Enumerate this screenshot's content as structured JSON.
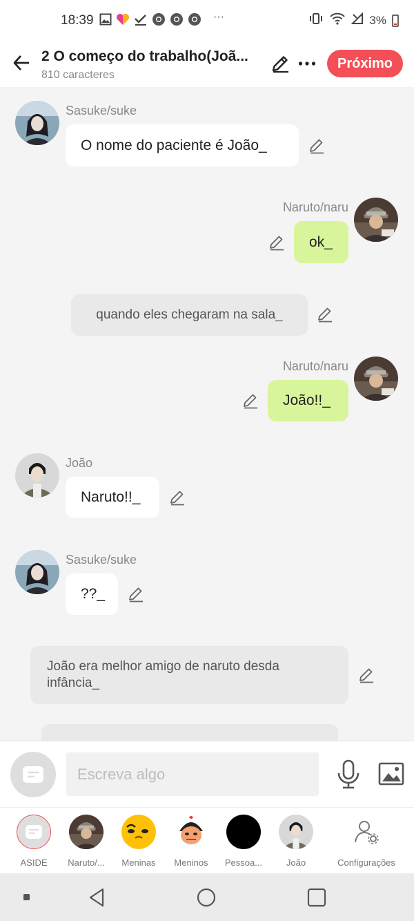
{
  "status_bar": {
    "time": "18:39",
    "battery": "3%"
  },
  "header": {
    "title": "2 O começo do trabalho(Joã...",
    "character_count": "810 caracteres",
    "next_label": "Próximo"
  },
  "messages": [
    {
      "kind": "left",
      "name": "Sasuke/suke",
      "text": "O nome do paciente é João_"
    },
    {
      "kind": "right",
      "name": "Naruto/naru",
      "text": "ok_"
    },
    {
      "kind": "narration",
      "text": "quando eles chegaram na sala_"
    },
    {
      "kind": "right",
      "name": "Naruto/naru",
      "text": "João!!_"
    },
    {
      "kind": "left",
      "name": "João",
      "text": "Naruto!!_"
    },
    {
      "kind": "left",
      "name": "Sasuke/suke",
      "text": "??_"
    },
    {
      "kind": "narration",
      "text": "João era melhor amigo de naruto desda infância_"
    }
  ],
  "composer": {
    "placeholder": "Escreva algo"
  },
  "characters": [
    {
      "label": "ASIDE"
    },
    {
      "label": "Naruto/..."
    },
    {
      "label": "Meninas"
    },
    {
      "label": "Meninos"
    },
    {
      "label": "Pessoa..."
    },
    {
      "label": "João"
    },
    {
      "label": "Configurações"
    }
  ],
  "colors": {
    "accent": "#f44e57",
    "bubble_green": "#d9f59b",
    "bubble_white": "#ffffff",
    "narration": "#e9e9e9"
  }
}
